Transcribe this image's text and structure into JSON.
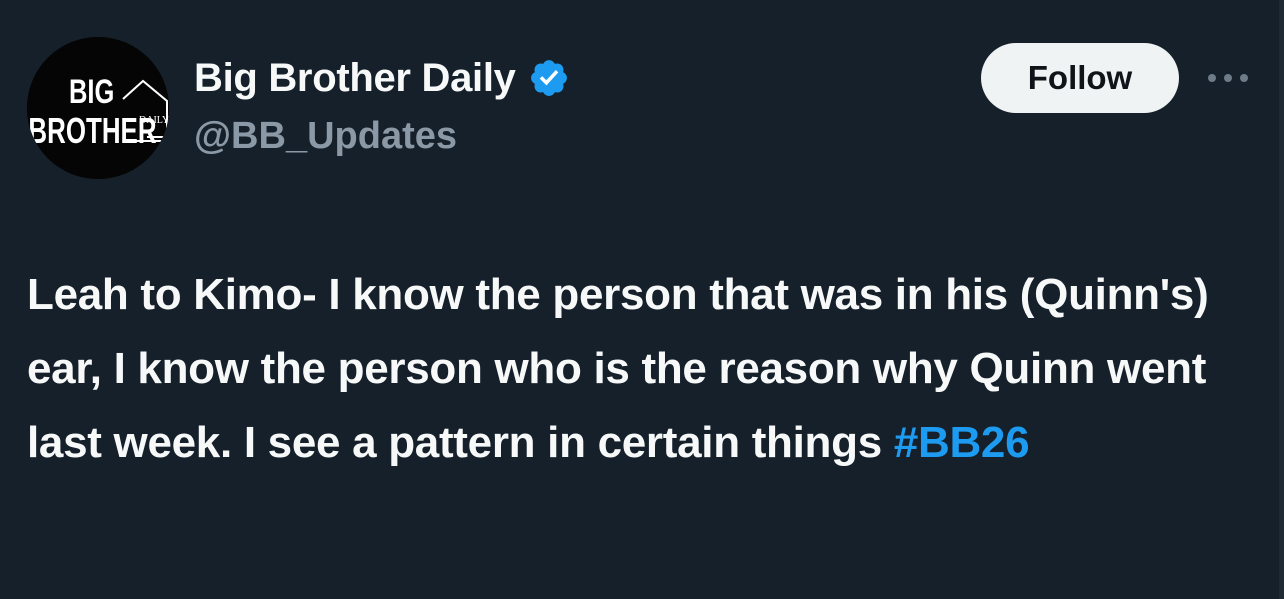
{
  "author": {
    "display_name": "Big Brother Daily",
    "handle": "@BB_Updates",
    "verified": true,
    "avatar_text_top": "BIG",
    "avatar_text_bottom": "BROTHER",
    "avatar_text_small": "DAILY"
  },
  "actions": {
    "follow_label": "Follow",
    "more_icon": "more-horizontal-icon"
  },
  "tweet": {
    "body": "Leah to Kimo- I know the person that was in his (Quinn's) ear, I know the person who is the reason why Quinn went last week. I see a pattern in certain things ",
    "hashtag": "#BB26"
  },
  "colors": {
    "background": "#15202b",
    "text_primary": "#f7f9f9",
    "text_secondary": "#8b98a5",
    "accent": "#1d9bf0",
    "follow_bg": "#eff3f4"
  }
}
